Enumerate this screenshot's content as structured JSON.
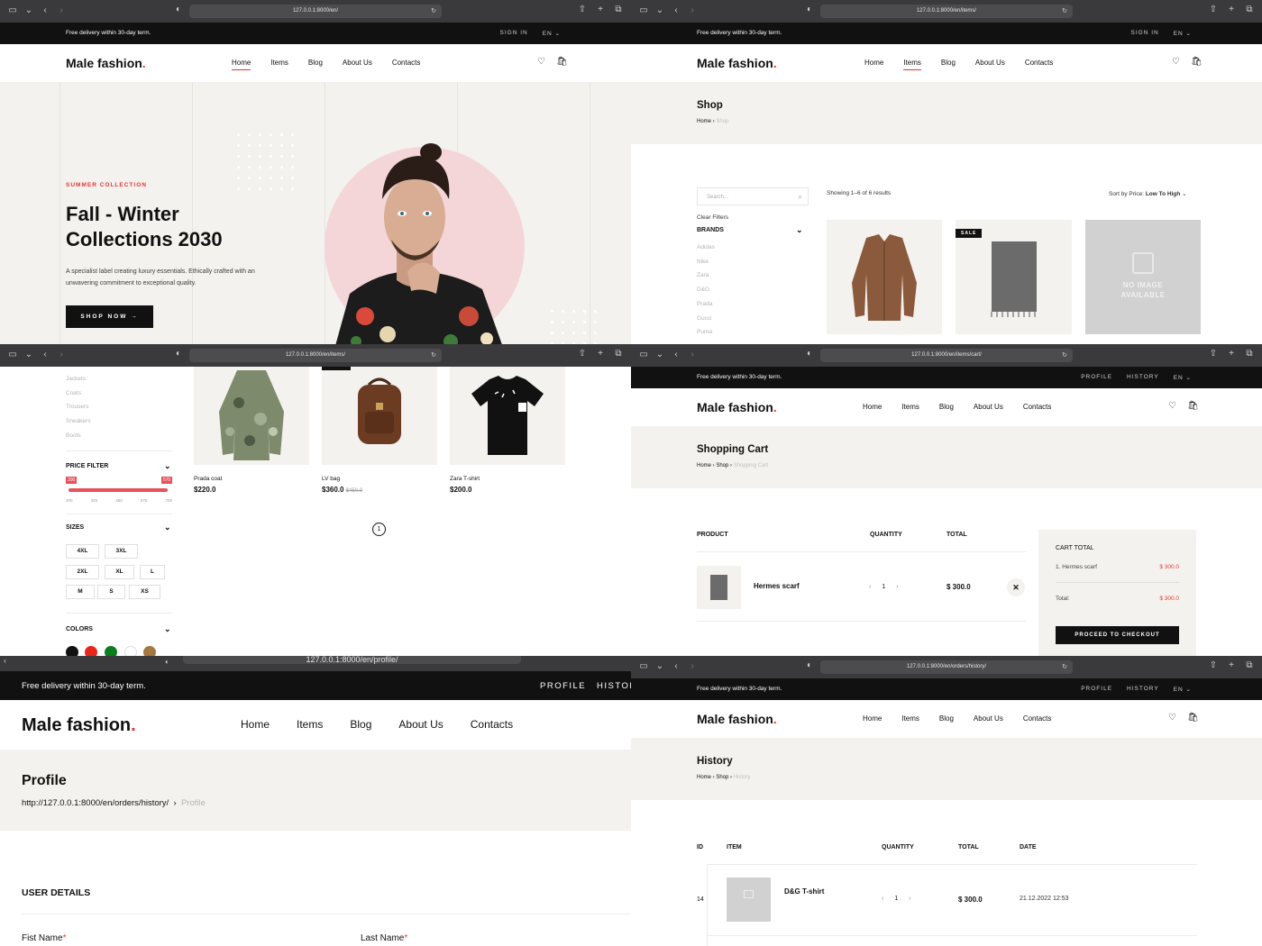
{
  "common": {
    "delivery": "Free delivery within 30-day term.",
    "sign_in": "SIGN IN",
    "lang": "EN",
    "profile": "PROFILE",
    "history": "HISTORY",
    "history_cut": "HISTOR",
    "logo_text": "Male fashion",
    "logo_dot": ".",
    "nav": [
      "Home",
      "Items",
      "Blog",
      "About Us",
      "Contacts"
    ],
    "accent": "#e53637"
  },
  "p1": {
    "url": "127.0.0.1:8000/en/",
    "eyebrow": "SUMMER COLLECTION",
    "title": "Fall - Winter Collections 2030",
    "desc": "A specialist label creating luxury essentials. Ethically crafted with an unwavering commitment to exceptional quality.",
    "cta": "SHOP NOW"
  },
  "p2": {
    "url": "127.0.0.1:8000/en/items/",
    "title": "Shop",
    "crumb_home": "Home",
    "crumb_current": "Shop",
    "search_placeholder": "Search...",
    "clear_filters": "Clear Filters",
    "brands_heading": "BRANDS",
    "brands": [
      "Adidas",
      "Nike",
      "Zara",
      "D&G",
      "Prada",
      "Gucci",
      "Puma"
    ],
    "showing": "Showing 1–6 of 6 results",
    "sort_label": "Sort by Price:",
    "sort_value": "Low To High",
    "sale": "SALE",
    "no_image_1": "NO IMAGE",
    "no_image_2": "AVAILABLE"
  },
  "p3": {
    "url": "127.0.0.1:8000/en/items/",
    "categories": [
      "Jackets",
      "Coats",
      "Trousers",
      "Sneakers",
      "Boots"
    ],
    "price_heading": "PRICE FILTER",
    "price_min": "200",
    "price_max": "570",
    "price_ticks": [
      "200",
      "325",
      "450",
      "575",
      "700"
    ],
    "sizes_heading": "SIZES",
    "sizes": [
      "4XL",
      "3XL",
      "2XL",
      "XL",
      "L",
      "M",
      "S",
      "XS"
    ],
    "colors_heading": "COLORS",
    "colors": [
      "#111111",
      "#e8261c",
      "#0a7d1f",
      "#ffffff",
      "#a57742"
    ],
    "products": [
      {
        "name": "Prada coat",
        "price": "$220.0",
        "old": ""
      },
      {
        "name": "LV bag",
        "price": "$360.0",
        "old": "$450.0"
      },
      {
        "name": "Zara T-shirt",
        "price": "$200.0",
        "old": ""
      }
    ],
    "page": "1"
  },
  "p4": {
    "url": "127.0.0.1:8000/en/items/cart/",
    "title": "Shopping Cart",
    "crumb_home": "Home",
    "crumb_shop": "Shop",
    "crumb_current": "Shopping Cart",
    "col_product": "PRODUCT",
    "col_quantity": "QUANTITY",
    "col_total": "TOTAL",
    "item_name": "Hermes scarf",
    "qty": "1",
    "item_total": "$ 300.0",
    "cart_total_heading": "CART TOTAL",
    "line_label": "1. Hermes scarf",
    "line_value": "$ 300.0",
    "total_label": "Total:",
    "total_value": "$ 300.0",
    "checkout": "PROCEED TO CHECKOUT"
  },
  "p5": {
    "url": "127.0.0.1:8000/en/profile/",
    "title": "Profile",
    "crumb_link": "http://127.0.0.1:8000/en/orders/history/",
    "crumb_current": "Profile",
    "section": "USER DETAILS",
    "first_name": "Fist Name",
    "last_name": "Last Name",
    "required": "*"
  },
  "p6": {
    "url": "127.0.0.1:8000/en/orders/history/",
    "title": "History",
    "crumb_home": "Home",
    "crumb_shop": "Shop",
    "crumb_current": "History",
    "col_id": "ID",
    "col_item": "ITEM",
    "col_quantity": "QUANTITY",
    "col_total": "TOTAL",
    "col_date": "DATE",
    "row_id": "14",
    "row_item": "D&G T-shirt",
    "row_qty": "1",
    "row_total": "$ 300.0",
    "row_date": "21.12.2022 12:53"
  }
}
